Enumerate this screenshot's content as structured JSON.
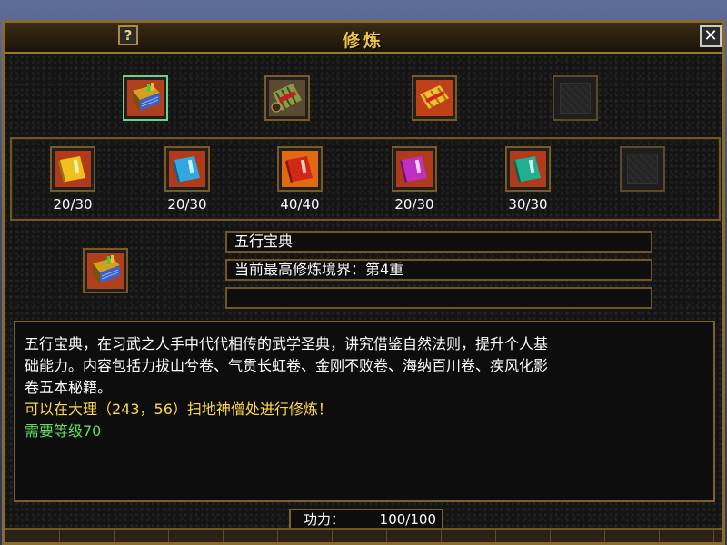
{
  "window": {
    "title": "修炼",
    "help_label": "?",
    "close_label": "✕"
  },
  "top_slots": [
    {
      "icon": "blue-manual-book-icon",
      "selected": true
    },
    {
      "icon": "bamboo-scroll-bundle-icon",
      "selected": false
    },
    {
      "icon": "golden-scroll-bundle-icon",
      "selected": false
    },
    {
      "icon": "empty-slot-icon",
      "selected": false
    }
  ],
  "book_slots": [
    {
      "icon": "yellow-book-icon",
      "count": "20/30",
      "color": "#e8b020"
    },
    {
      "icon": "blue-book-icon",
      "count": "20/30",
      "color": "#30a8e0"
    },
    {
      "icon": "red-book-icon",
      "count": "40/40",
      "color": "#d83a20"
    },
    {
      "icon": "purple-book-icon",
      "count": "20/30",
      "color": "#c030c0"
    },
    {
      "icon": "teal-book-icon",
      "count": "30/30",
      "color": "#20b090"
    },
    {
      "icon": "empty-slot-icon",
      "count": "",
      "color": ""
    }
  ],
  "selected": {
    "icon": "blue-manual-book-icon",
    "name": "五行宝典",
    "realm": "当前最高修炼境界：第4重",
    "extra": ""
  },
  "description": {
    "lines": [
      "五行宝典，在习武之人手中代代相传的武学圣典，讲究借鉴自然法则，提升个人基",
      "础能力。内容包括力拔山兮卷、气贯长虹卷、金刚不败卷、海纳百川卷、疾风化影",
      "卷五本秘籍。"
    ],
    "location": "可以在大理（243，56）扫地神僧处进行修炼！",
    "requirement": "需要等级70"
  },
  "power": {
    "label": "功力：",
    "value": "100/100"
  }
}
